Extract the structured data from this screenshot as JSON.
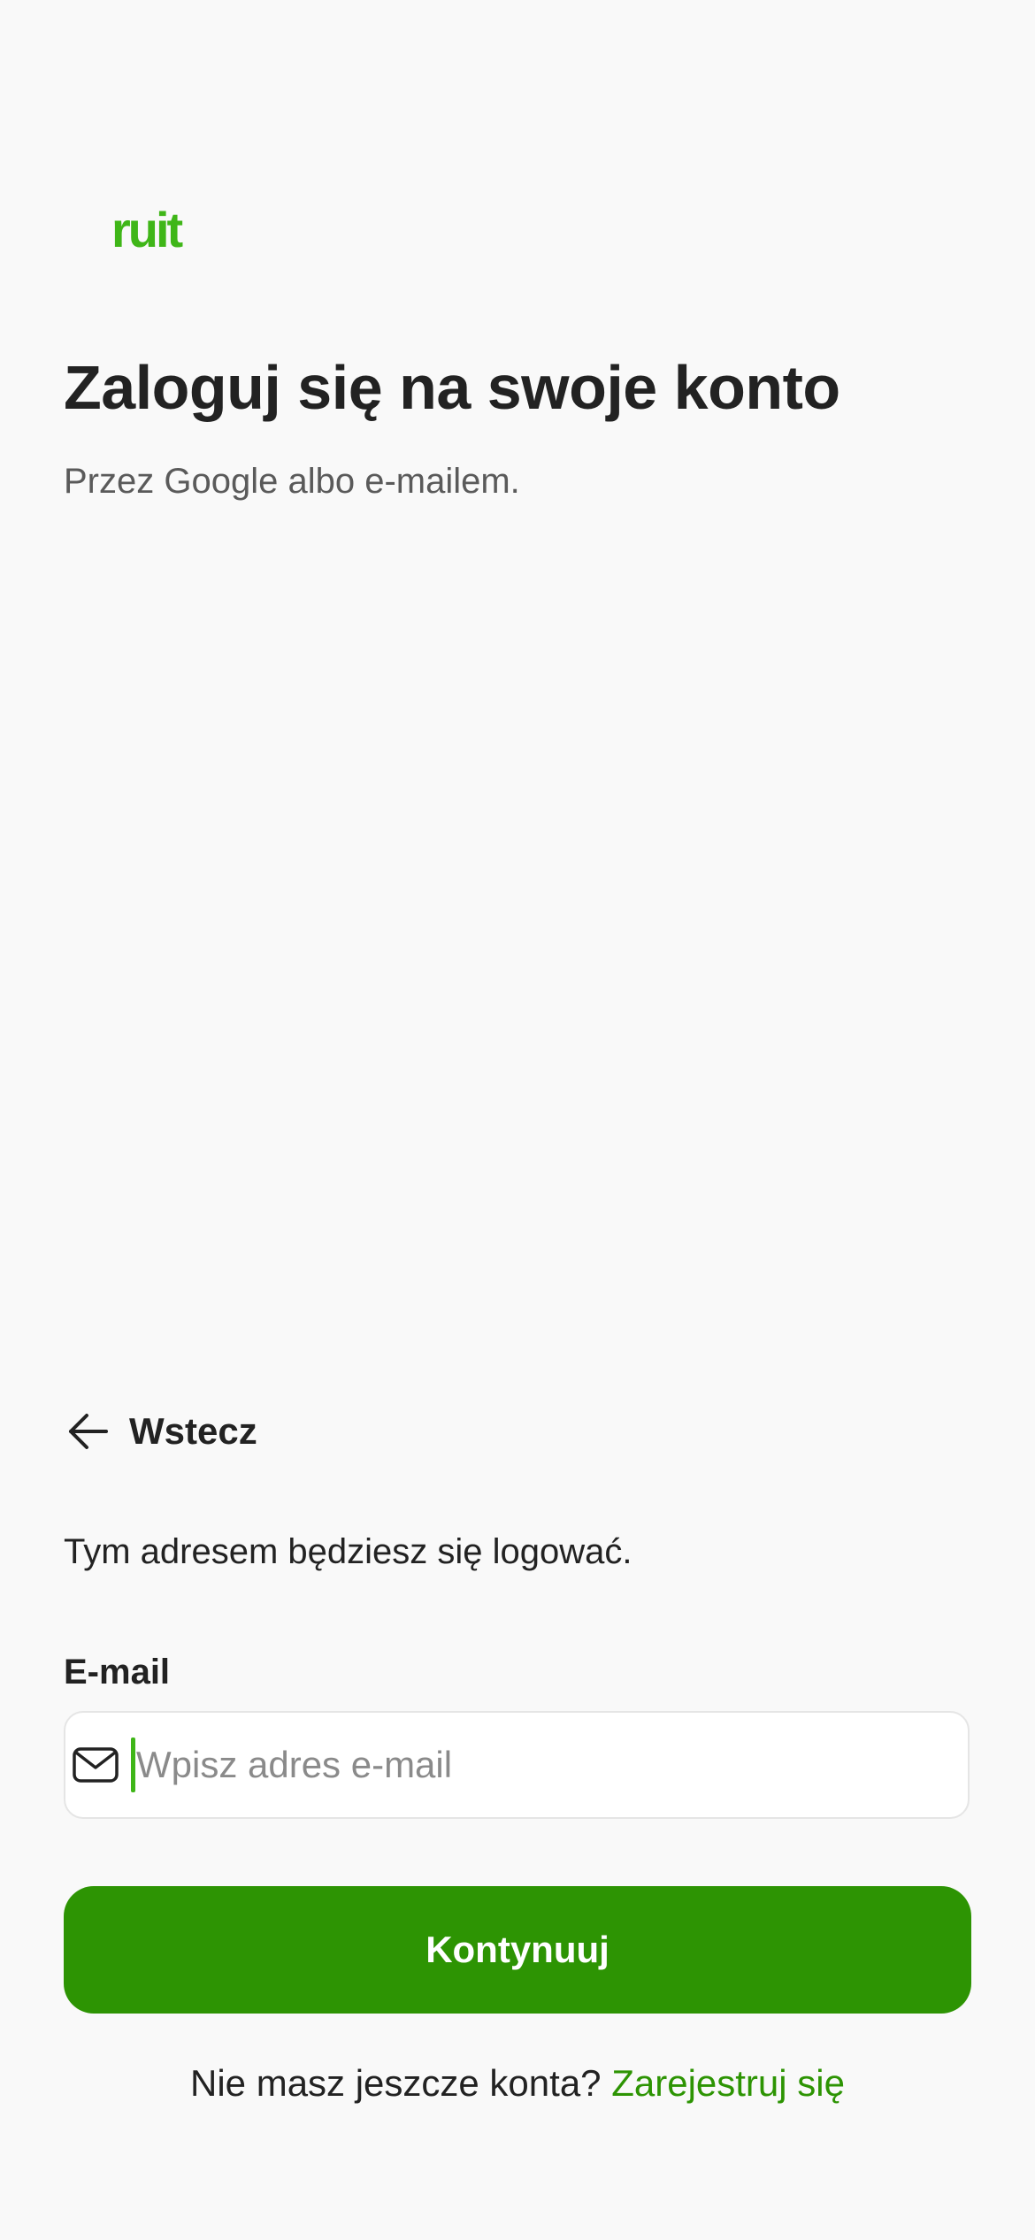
{
  "brand": {
    "logo_text": "ruit",
    "accent_color": "#3fb618",
    "button_color": "#2d9403"
  },
  "header": {
    "title": "Zaloguj się na swoje konto",
    "subtitle": "Przez Google albo e-mailem."
  },
  "back": {
    "label": "Wstecz",
    "icon": "arrow-left-icon"
  },
  "form": {
    "hint": "Tym adresem będziesz się logować.",
    "email_label": "E-mail",
    "email_placeholder": "Wpisz adres e-mail",
    "email_value": "",
    "email_icon": "mail-icon",
    "submit_label": "Kontynuuj"
  },
  "footer": {
    "question": "Nie masz jeszcze konta?",
    "signup_link": "Zarejestruj się"
  }
}
